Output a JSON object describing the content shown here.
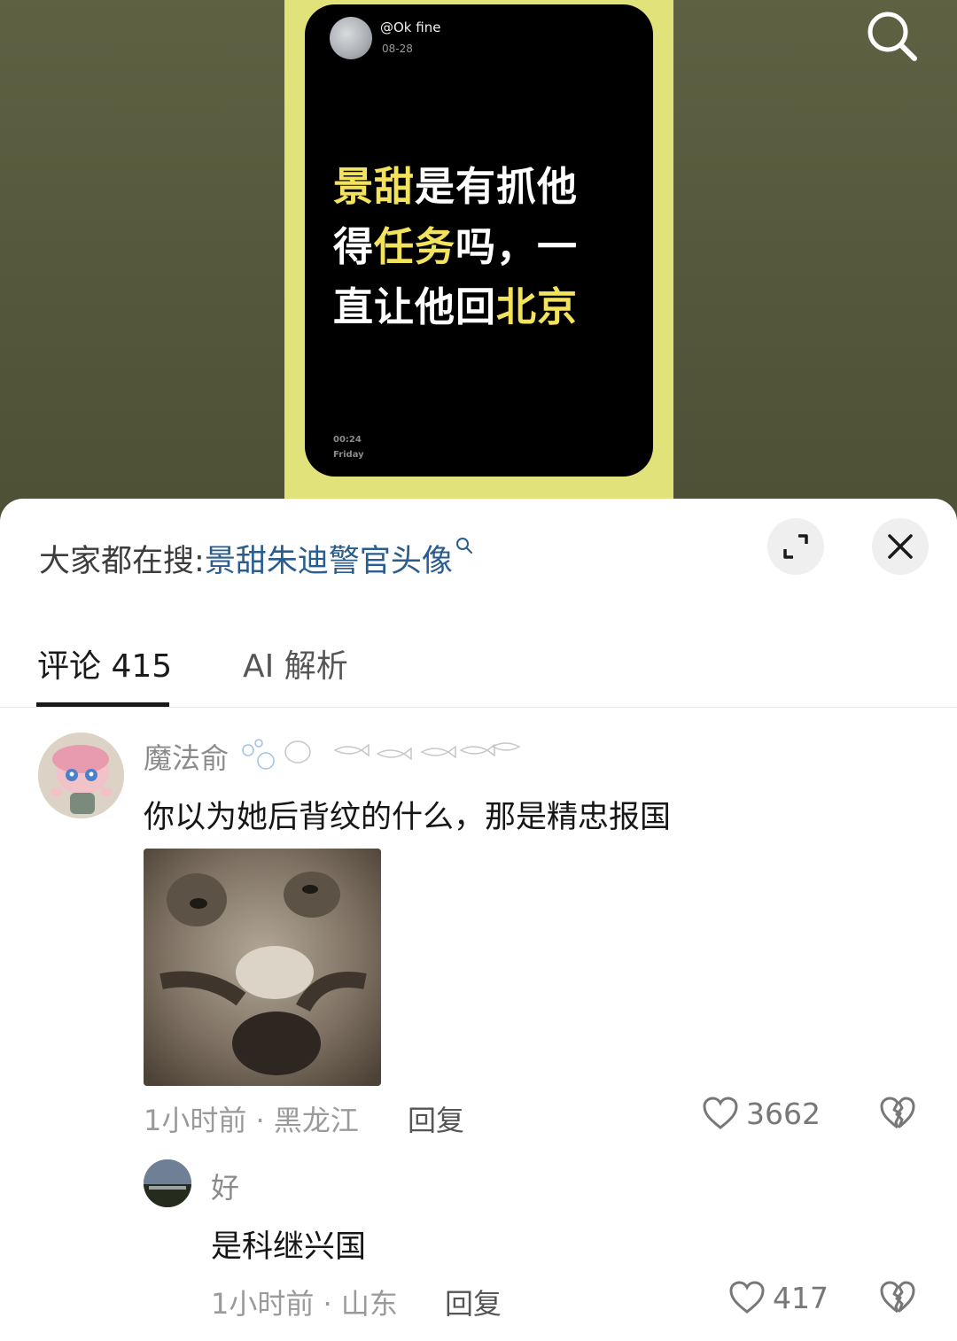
{
  "video": {
    "poster_handle": "@Ok fine",
    "poster_date": "08-28",
    "caption_segments": [
      {
        "text": "景甜",
        "highlight": true
      },
      {
        "text": "是有抓他得",
        "highlight": false
      },
      {
        "text": "任务",
        "highlight": true
      },
      {
        "text": "吗，一直让他回",
        "highlight": false
      },
      {
        "text": "北京",
        "highlight": true
      }
    ],
    "time": "00:24",
    "day": "Friday",
    "search_icon": "search-icon"
  },
  "sheet": {
    "hot_search_label": "大家都在搜",
    "hot_search_separator": ":",
    "hot_search_keyword": "景甜朱迪警官头像",
    "expand_icon": "expand-icon",
    "close_icon": "close-icon",
    "tabs": [
      {
        "label": "评论 415",
        "active": true
      },
      {
        "label": "AI 解析",
        "active": false
      }
    ]
  },
  "comments": [
    {
      "username": "魔法俞",
      "text": "你以为她后背纹的什么，那是精忠报国",
      "meta": "1小时前 · 黑龙江",
      "reply_label": "回复",
      "likes": "3662"
    }
  ],
  "replies": [
    {
      "username": "好",
      "text": "是科继兴国",
      "meta": "1小时前 · 山东",
      "reply_label": "回复",
      "likes": "417"
    }
  ],
  "colors": {
    "highlight_yellow": "#f3e35c",
    "frame_yellow": "#e1e27a",
    "keyword_blue": "#2a5d8f"
  }
}
